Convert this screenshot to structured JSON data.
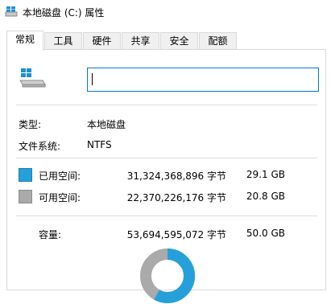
{
  "window": {
    "title": "本地磁盘 (C:) 属性"
  },
  "tabs": [
    {
      "label": "常规",
      "active": true
    },
    {
      "label": "工具",
      "active": false
    },
    {
      "label": "硬件",
      "active": false
    },
    {
      "label": "共享",
      "active": false
    },
    {
      "label": "安全",
      "active": false
    },
    {
      "label": "配额",
      "active": false
    }
  ],
  "general": {
    "drive_name_value": "",
    "type_label": "类型:",
    "type_value": "本地磁盘",
    "fs_label": "文件系统:",
    "fs_value": "NTFS",
    "used_label": "已用空间:",
    "used_bytes": "31,324,368,896 字节",
    "used_gb": "29.1 GB",
    "free_label": "可用空间:",
    "free_bytes": "22,370,226,176 字节",
    "free_gb": "20.8 GB",
    "capacity_label": "容量:",
    "capacity_bytes": "53,694,595,072 字节",
    "capacity_gb": "50.0 GB"
  },
  "colors": {
    "used": "#26a0da",
    "free": "#aaaaaa",
    "focus": "#0078d7"
  },
  "icons": [
    "drive-properties-icon",
    "hard-drive-icon"
  ]
}
